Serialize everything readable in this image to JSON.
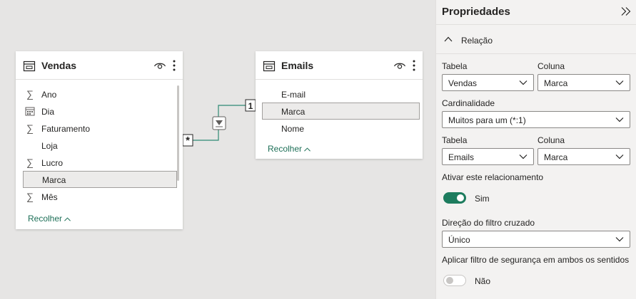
{
  "tables": [
    {
      "name": "Vendas",
      "fields": [
        {
          "name": "Ano",
          "icon": "sigma-icon",
          "glyph": "∑"
        },
        {
          "name": "Dia",
          "icon": "calendar-icon",
          "glyph": ""
        },
        {
          "name": "Faturamento",
          "icon": "sigma-icon",
          "glyph": "∑"
        },
        {
          "name": "Loja",
          "icon": "",
          "glyph": ""
        },
        {
          "name": "Lucro",
          "icon": "sigma-icon",
          "glyph": "∑"
        },
        {
          "name": "Marca",
          "icon": "",
          "glyph": "",
          "selected": true
        },
        {
          "name": "Mês",
          "icon": "sigma-icon",
          "glyph": "∑"
        }
      ],
      "collapse_label": "Recolher"
    },
    {
      "name": "Emails",
      "fields": [
        {
          "name": "E-mail",
          "icon": "",
          "glyph": ""
        },
        {
          "name": "Marca",
          "icon": "",
          "glyph": "",
          "selected": true
        },
        {
          "name": "Nome",
          "icon": "",
          "glyph": ""
        }
      ],
      "collapse_label": "Recolher"
    }
  ],
  "relationship": {
    "many_marker": "*",
    "one_marker": "1",
    "color": "#2e8b73"
  },
  "properties": {
    "title": "Propriedades",
    "section": "Relação",
    "table1_label": "Tabela",
    "column1_label": "Coluna",
    "table1_value": "Vendas",
    "column1_value": "Marca",
    "cardinality_label": "Cardinalidade",
    "cardinality_value": "Muitos para um (*:1)",
    "table2_label": "Tabela",
    "column2_label": "Coluna",
    "table2_value": "Emails",
    "column2_value": "Marca",
    "activate_label": "Ativar este relacionamento",
    "activate_state": "Sim",
    "cross_filter_label": "Direção do filtro cruzado",
    "cross_filter_value": "Único",
    "security_label": "Aplicar filtro de segurança em ambos os sentidos",
    "security_state": "Não"
  },
  "colors": {
    "accent": "#1d7c5e",
    "link": "#1d6f57",
    "selected_bg": "#ecebea"
  }
}
